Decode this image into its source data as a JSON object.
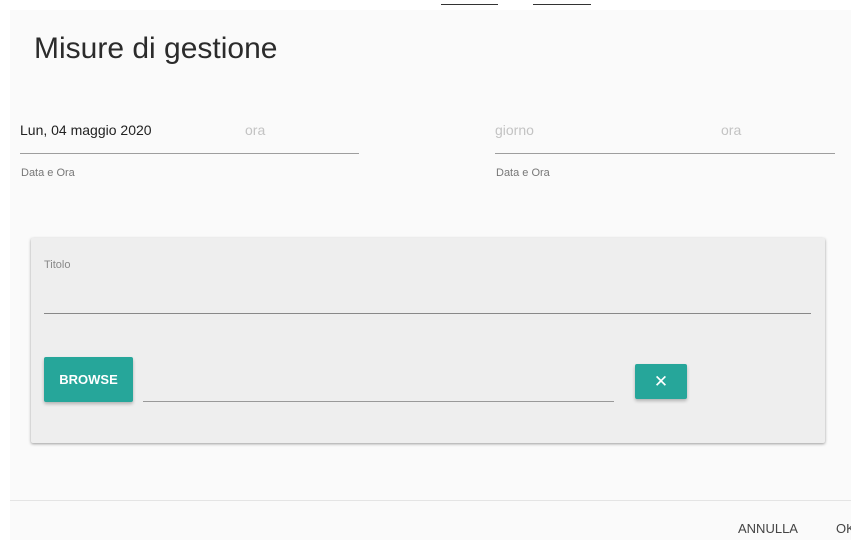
{
  "dialog": {
    "title": "Misure di gestione"
  },
  "start_datetime": {
    "date_value": "Lun, 04 maggio 2020",
    "time_placeholder": "ora",
    "hint": "Data e Ora"
  },
  "end_datetime": {
    "date_placeholder": "giorno",
    "time_placeholder": "ora",
    "hint": "Data e Ora"
  },
  "attachment": {
    "title_label": "Titolo",
    "browse_label": "BROWSE",
    "clear_icon": "close-icon"
  },
  "footer": {
    "cancel_label": "ANNULLA",
    "ok_label": "OK"
  },
  "colors": {
    "accent": "#26a69a",
    "dialog_bg": "#fafafa",
    "card_bg": "#eeeeee"
  }
}
